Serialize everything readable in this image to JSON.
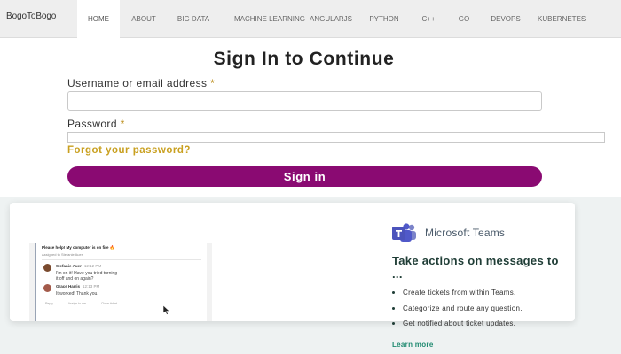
{
  "nav": {
    "brand": "BogoToBogo",
    "items": [
      {
        "label": "HOME",
        "active": true
      },
      {
        "label": "ABOUT",
        "active": false
      },
      {
        "label": "BIG DATA",
        "active": false
      },
      {
        "label": "MACHINE LEARNING",
        "active": false
      },
      {
        "label": "ANGULARJS",
        "active": false
      },
      {
        "label": "PYTHON",
        "active": false
      },
      {
        "label": "C++",
        "active": false
      },
      {
        "label": "GO",
        "active": false
      },
      {
        "label": "DEVOPS",
        "active": false
      },
      {
        "label": "KUBERNETES",
        "active": false
      }
    ]
  },
  "signin": {
    "title": "Sign In to Continue",
    "username_label": "Username or email address",
    "password_label": "Password",
    "required_mark": "*",
    "username_value": "",
    "password_value": "",
    "forgot_link": "Forgot your password?",
    "submit_label": "Sign in",
    "accent_color": "#8a0a72"
  },
  "promo": {
    "chat": {
      "header": "Please help! My computer is on fire 🔥",
      "assigned": "Assigned to Stefanie Auer",
      "messages": [
        {
          "author": "Stefanie Auer",
          "time": "12:12 PM",
          "lines": [
            "I'm on it! Have you tried turning",
            "it off and on again?"
          ]
        },
        {
          "author": "Grace Harris",
          "time": "12:13 PM",
          "lines": [
            "It worked! Thank you."
          ]
        }
      ],
      "actions": [
        "Reply",
        "Assign to me",
        "Close ticket"
      ]
    },
    "brand_name": "Microsoft Teams",
    "headline": "Take actions on messages to ...",
    "bullets": [
      "Create tickets from within Teams.",
      "Categorize and route any question.",
      "Get notified about ticket updates."
    ],
    "learn_more": "Learn more",
    "icons": {
      "teams": "microsoft-teams-icon",
      "cursor": "mouse-cursor-icon"
    }
  }
}
